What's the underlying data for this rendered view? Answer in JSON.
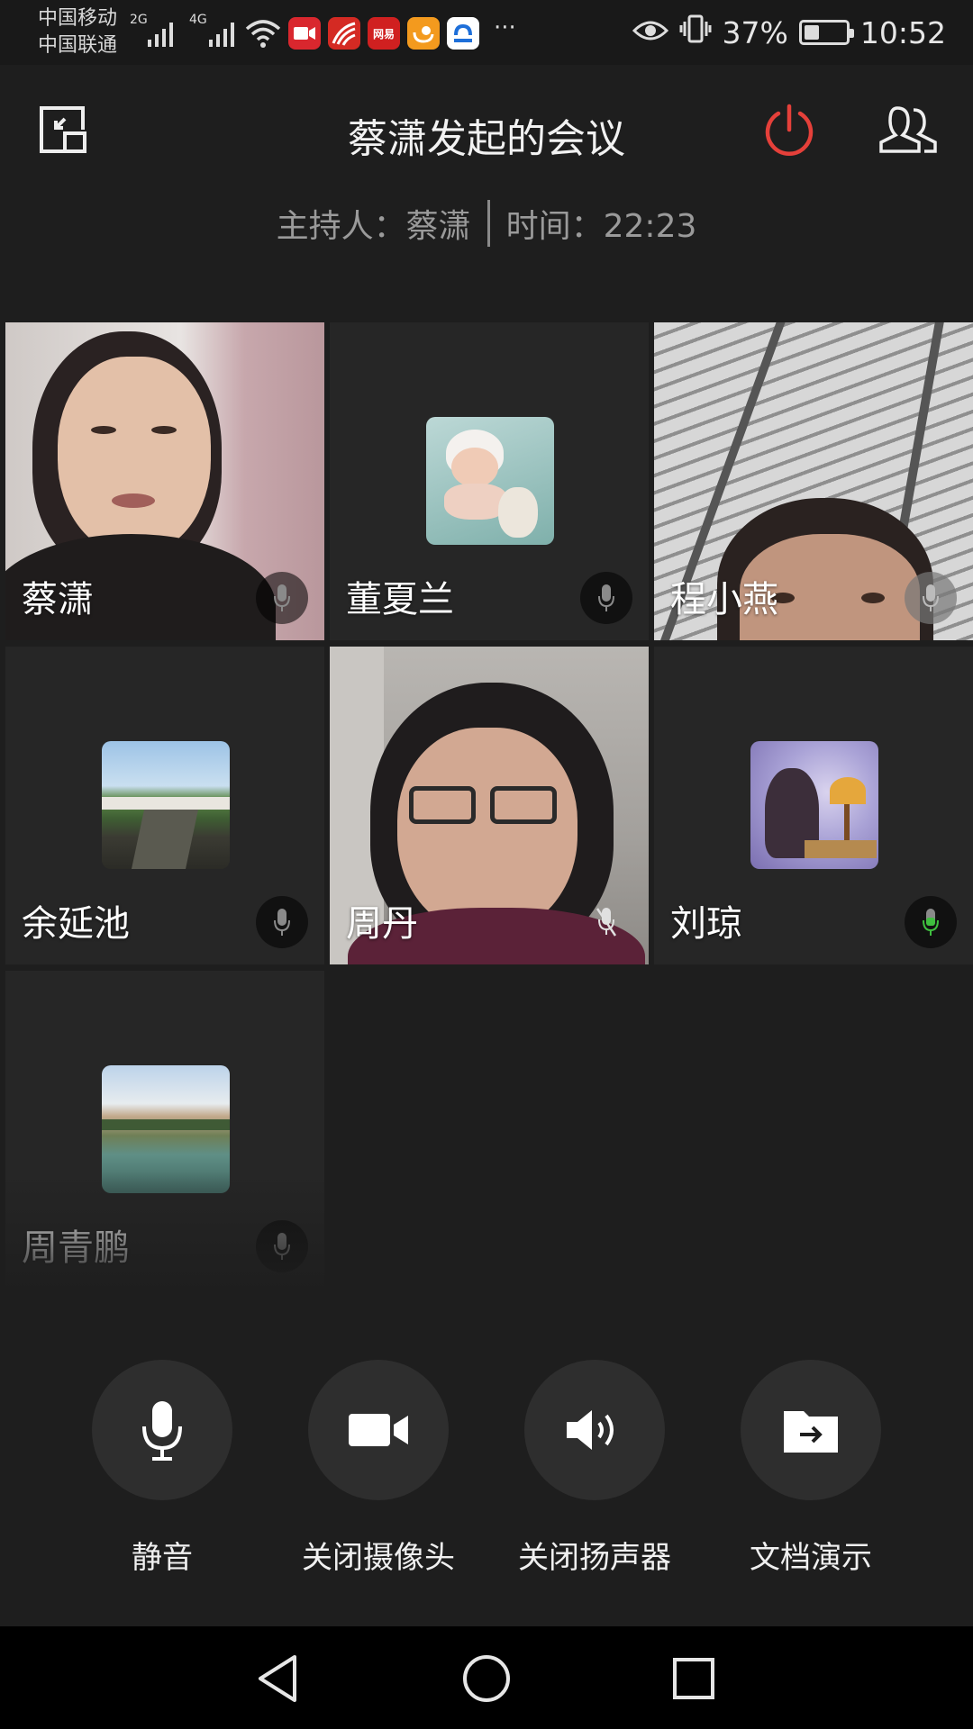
{
  "status_bar": {
    "carrier_1": "中国移动",
    "carrier_2": "中国联通",
    "network_1": "2G",
    "network_2": "4G",
    "apps": [
      "video-app-icon",
      "xuexi-app-icon",
      "netease-app-icon",
      "uc-browser-app-icon",
      "browser-app-icon"
    ],
    "netease_label": "网易",
    "more": "···",
    "battery": "37%",
    "battery_level": 0.37,
    "time": "10:52"
  },
  "header": {
    "title": "蔡潇发起的会议",
    "host_label": "主持人：蔡潇",
    "time_label": "时间：22:23",
    "end_color": "#e5403a"
  },
  "participants": [
    {
      "name": "蔡潇",
      "type": "video",
      "mic": "on"
    },
    {
      "name": "董夏兰",
      "type": "avatar",
      "mic": "on"
    },
    {
      "name": "程小燕",
      "type": "video",
      "mic": "on"
    },
    {
      "name": "余延池",
      "type": "avatar",
      "mic": "on"
    },
    {
      "name": "周丹",
      "type": "video",
      "mic": "muted"
    },
    {
      "name": "刘琼",
      "type": "avatar",
      "mic": "speaking"
    },
    {
      "name": "周青鹏",
      "type": "avatar",
      "mic": "on"
    }
  ],
  "controls": {
    "mute": "静音",
    "camera": "关闭摄像头",
    "speaker": "关闭扬声器",
    "present": "文档演示"
  },
  "colors": {
    "speaking": "#3fbf3f",
    "background": "#1e1e1e"
  }
}
